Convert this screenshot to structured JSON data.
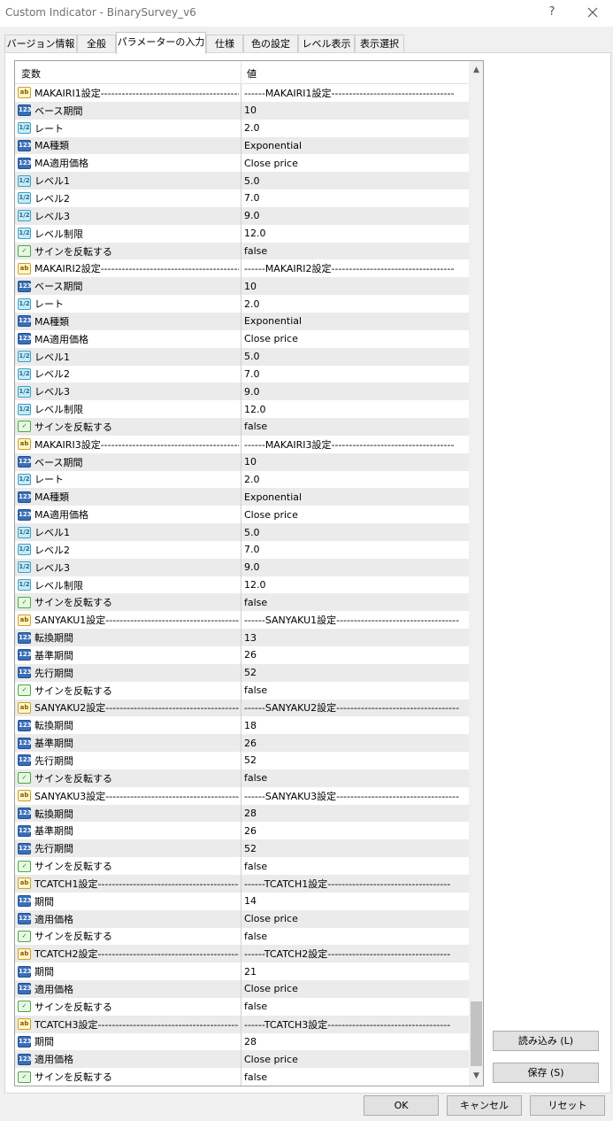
{
  "window": {
    "title": "Custom Indicator - BinarySurvey_v6",
    "help_label": "?"
  },
  "tabs": [
    {
      "label": "バージョン情報"
    },
    {
      "label": "全般"
    },
    {
      "label": "パラメーターの入力",
      "active": true
    },
    {
      "label": "仕様"
    },
    {
      "label": "色の設定"
    },
    {
      "label": "レベル表示"
    },
    {
      "label": "表示選択"
    }
  ],
  "grid": {
    "col_variable": "変数",
    "col_value": "値",
    "icon_types": {
      "str": {
        "glyph": "ab",
        "name": "string-type-icon"
      },
      "int": {
        "glyph": "123",
        "name": "integer-type-icon"
      },
      "dbl": {
        "glyph": "1/2",
        "name": "double-type-icon"
      },
      "bool": {
        "glyph": "✓",
        "name": "boolean-type-icon"
      }
    },
    "rows": [
      {
        "type": "str",
        "name": "MAKAIRI1設定-----------------------------------------",
        "value": "------MAKAIRI1設定-----------------------------------"
      },
      {
        "type": "int",
        "name": "ベース期間",
        "value": "10"
      },
      {
        "type": "dbl",
        "name": "レート",
        "value": "2.0"
      },
      {
        "type": "int",
        "name": "MA種類",
        "value": "Exponential"
      },
      {
        "type": "int",
        "name": "MA適用価格",
        "value": "Close price"
      },
      {
        "type": "dbl",
        "name": "レベル1",
        "value": "5.0"
      },
      {
        "type": "dbl",
        "name": "レベル2",
        "value": "7.0"
      },
      {
        "type": "dbl",
        "name": "レベル3",
        "value": "9.0"
      },
      {
        "type": "dbl",
        "name": "レベル制限",
        "value": "12.0"
      },
      {
        "type": "bool",
        "name": "サインを反転する",
        "value": "false"
      },
      {
        "type": "str",
        "name": "MAKAIRI2設定-----------------------------------------",
        "value": "------MAKAIRI2設定-----------------------------------"
      },
      {
        "type": "int",
        "name": "ベース期間",
        "value": "10"
      },
      {
        "type": "dbl",
        "name": "レート",
        "value": "2.0"
      },
      {
        "type": "int",
        "name": "MA種類",
        "value": "Exponential"
      },
      {
        "type": "int",
        "name": "MA適用価格",
        "value": "Close price"
      },
      {
        "type": "dbl",
        "name": "レベル1",
        "value": "5.0"
      },
      {
        "type": "dbl",
        "name": "レベル2",
        "value": "7.0"
      },
      {
        "type": "dbl",
        "name": "レベル3",
        "value": "9.0"
      },
      {
        "type": "dbl",
        "name": "レベル制限",
        "value": "12.0"
      },
      {
        "type": "bool",
        "name": "サインを反転する",
        "value": "false"
      },
      {
        "type": "str",
        "name": "MAKAIRI3設定-----------------------------------------",
        "value": "------MAKAIRI3設定-----------------------------------"
      },
      {
        "type": "int",
        "name": "ベース期間",
        "value": "10"
      },
      {
        "type": "dbl",
        "name": "レート",
        "value": "2.0"
      },
      {
        "type": "int",
        "name": "MA種類",
        "value": "Exponential"
      },
      {
        "type": "int",
        "name": "MA適用価格",
        "value": "Close price"
      },
      {
        "type": "dbl",
        "name": "レベル1",
        "value": "5.0"
      },
      {
        "type": "dbl",
        "name": "レベル2",
        "value": "7.0"
      },
      {
        "type": "dbl",
        "name": "レベル3",
        "value": "9.0"
      },
      {
        "type": "dbl",
        "name": "レベル制限",
        "value": "12.0"
      },
      {
        "type": "bool",
        "name": "サインを反転する",
        "value": "false"
      },
      {
        "type": "str",
        "name": "SANYAKU1設定-----------------------------------------",
        "value": "------SANYAKU1設定-----------------------------------"
      },
      {
        "type": "int",
        "name": "転換期間",
        "value": "13"
      },
      {
        "type": "int",
        "name": "基準期間",
        "value": "26"
      },
      {
        "type": "int",
        "name": "先行期間",
        "value": "52"
      },
      {
        "type": "bool",
        "name": "サインを反転する",
        "value": "false"
      },
      {
        "type": "str",
        "name": "SANYAKU2設定-----------------------------------------",
        "value": "------SANYAKU2設定-----------------------------------"
      },
      {
        "type": "int",
        "name": "転換期間",
        "value": "18"
      },
      {
        "type": "int",
        "name": "基準期間",
        "value": "26"
      },
      {
        "type": "int",
        "name": "先行期間",
        "value": "52"
      },
      {
        "type": "bool",
        "name": "サインを反転する",
        "value": "false"
      },
      {
        "type": "str",
        "name": "SANYAKU3設定-----------------------------------------",
        "value": "------SANYAKU3設定-----------------------------------"
      },
      {
        "type": "int",
        "name": "転換期間",
        "value": "28"
      },
      {
        "type": "int",
        "name": "基準期間",
        "value": "26"
      },
      {
        "type": "int",
        "name": "先行期間",
        "value": "52"
      },
      {
        "type": "bool",
        "name": "サインを反転する",
        "value": "false"
      },
      {
        "type": "str",
        "name": "TCATCH1設定-----------------------------------------",
        "value": "------TCATCH1設定-----------------------------------"
      },
      {
        "type": "int",
        "name": "期間",
        "value": "14"
      },
      {
        "type": "int",
        "name": "適用価格",
        "value": "Close price"
      },
      {
        "type": "bool",
        "name": "サインを反転する",
        "value": "false"
      },
      {
        "type": "str",
        "name": "TCATCH2設定-----------------------------------------",
        "value": "------TCATCH2設定-----------------------------------"
      },
      {
        "type": "int",
        "name": "期間",
        "value": "21"
      },
      {
        "type": "int",
        "name": "適用価格",
        "value": "Close price"
      },
      {
        "type": "bool",
        "name": "サインを反転する",
        "value": "false"
      },
      {
        "type": "str",
        "name": "TCATCH3設定-----------------------------------------",
        "value": "------TCATCH3設定-----------------------------------"
      },
      {
        "type": "int",
        "name": "期間",
        "value": "28"
      },
      {
        "type": "int",
        "name": "適用価格",
        "value": "Close price"
      },
      {
        "type": "bool",
        "name": "サインを反転する",
        "value": "false"
      }
    ]
  },
  "scrollbar": {
    "up_glyph": "▲",
    "down_glyph": "▼"
  },
  "side_buttons": {
    "load_label": "読み込み (L)",
    "save_label": "保存 (S)"
  },
  "footer": {
    "ok_label": "OK",
    "cancel_label": "キャンセル",
    "reset_label": "リセット"
  }
}
